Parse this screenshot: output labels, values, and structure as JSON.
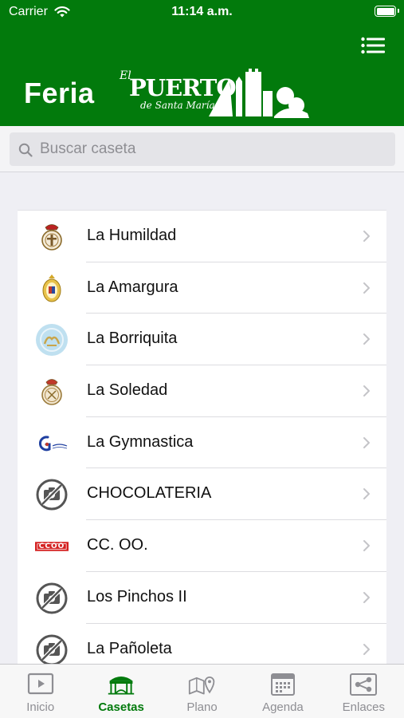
{
  "status_bar": {
    "carrier": "Carrier",
    "time": "11:14 a.m."
  },
  "header": {
    "logo": {
      "feria": "Feria",
      "el": "El",
      "puerto": "PUERTO",
      "subtitle": "de Santa María"
    },
    "background_color": "#027a0c",
    "menu_icon": "list-icon"
  },
  "search": {
    "placeholder": "Buscar caseta",
    "value": ""
  },
  "casetas": [
    {
      "name": "La Humildad",
      "icon": "crest-humildad-icon"
    },
    {
      "name": "La Amargura",
      "icon": "crest-amargura-icon"
    },
    {
      "name": "La Borriquita",
      "icon": "emblem-borriquita-icon"
    },
    {
      "name": "La Soledad",
      "icon": "crest-soledad-icon"
    },
    {
      "name": "La Gymnastica",
      "icon": "logo-gymnastica-icon"
    },
    {
      "name": "CHOCOLATERIA",
      "icon": "no-photo-icon"
    },
    {
      "name": "CC. OO.",
      "icon": "ccoo-logo-icon",
      "logo_text": "CCOO"
    },
    {
      "name": "Los Pinchos II",
      "icon": "no-photo-icon"
    },
    {
      "name": "La Pañoleta",
      "icon": "no-photo-icon"
    }
  ],
  "tabbar": {
    "active_color": "#027a0c",
    "inactive_color": "#8e8e93",
    "tabs": [
      {
        "label": "Inicio",
        "icon": "play-video-icon",
        "active": false
      },
      {
        "label": "Casetas",
        "icon": "caseta-tent-icon",
        "active": true
      },
      {
        "label": "Plano",
        "icon": "map-pin-icon",
        "active": false
      },
      {
        "label": "Agenda",
        "icon": "calendar-icon",
        "active": false
      },
      {
        "label": "Enlaces",
        "icon": "share-links-icon",
        "active": false
      }
    ]
  }
}
